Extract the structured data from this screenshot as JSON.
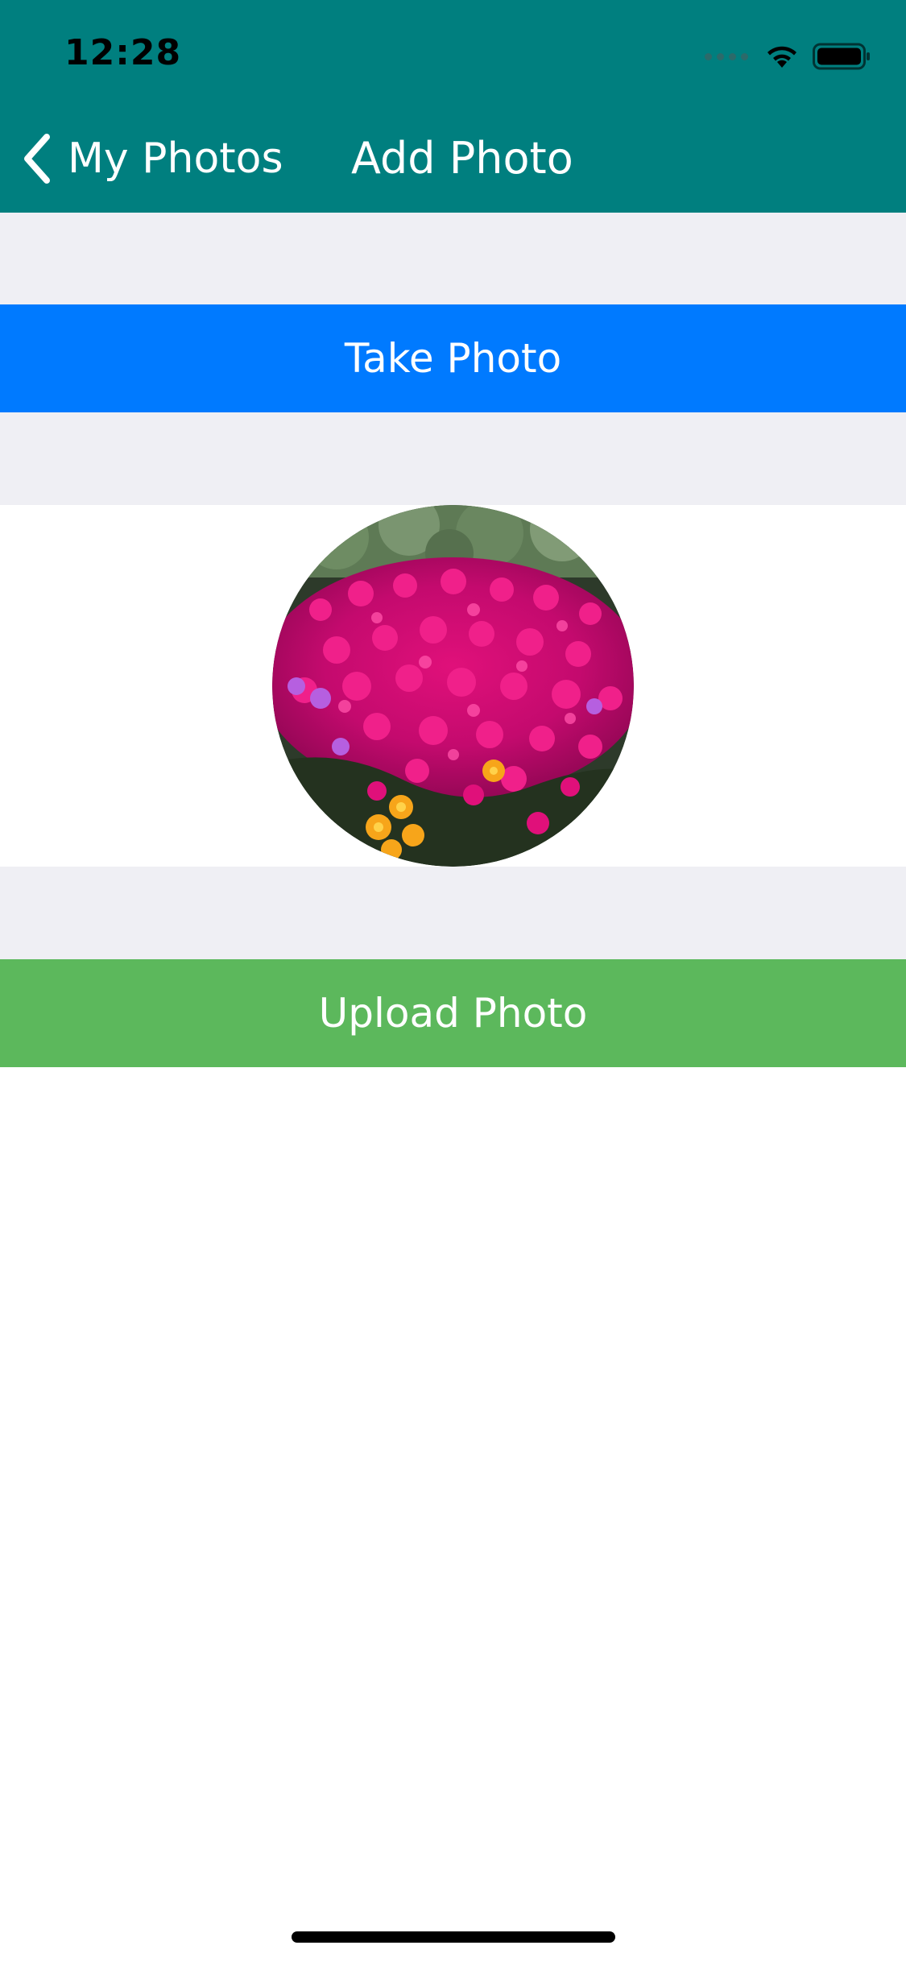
{
  "status_bar": {
    "time": "12:28",
    "signal_icon": "cellular-signal-icon",
    "wifi_icon": "wifi-icon",
    "battery_icon": "battery-icon"
  },
  "nav": {
    "back_label": "My Photos",
    "back_icon": "chevron-left-icon",
    "title": "Add Photo"
  },
  "actions": {
    "take_photo_label": "Take Photo",
    "upload_photo_label": "Upload Photo"
  },
  "photo": {
    "subject": "flower-bed-photo"
  },
  "colors": {
    "header": "#007F7F",
    "take_photo": "#007AFF",
    "upload_photo": "#5CB85C",
    "section_gap": "#EFEFF4",
    "text_on_color": "#FFFFFF"
  }
}
